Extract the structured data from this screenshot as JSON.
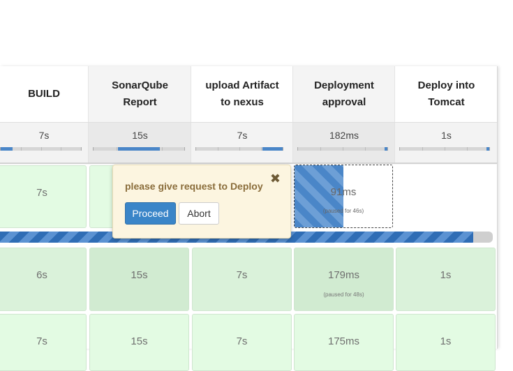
{
  "columns": [
    {
      "title": "BUILD"
    },
    {
      "title": "SonarQube Report"
    },
    {
      "title": "upload Artifact to nexus"
    },
    {
      "title": "Deployment approval"
    },
    {
      "title": "Deploy into Tomcat"
    }
  ],
  "averages": [
    {
      "text": "7s",
      "fill": 0.15
    },
    {
      "text": "15s",
      "fill": 0.46
    },
    {
      "text": "7s",
      "fill": 0.23
    },
    {
      "text": "182ms",
      "fill": 0.03
    },
    {
      "text": "1s",
      "fill": 0.03
    }
  ],
  "runs": [
    {
      "cells": [
        {
          "dur": "7s"
        },
        {
          "dur": ""
        },
        {
          "dur": ""
        },
        {
          "dur": "91ms",
          "note": "(paused for 46s)",
          "progress": 0.5
        },
        {
          "dur": ""
        }
      ]
    },
    {
      "cells": [
        {
          "dur": "6s"
        },
        {
          "dur": "15s"
        },
        {
          "dur": "7s"
        },
        {
          "dur": "179ms",
          "note": "(paused for 48s)"
        },
        {
          "dur": "1s"
        }
      ]
    },
    {
      "cells": [
        {
          "dur": "7s"
        },
        {
          "dur": "15s"
        },
        {
          "dur": "7s"
        },
        {
          "dur": "175ms"
        },
        {
          "dur": "1s"
        }
      ]
    }
  ],
  "run_progress": 0.96,
  "input_prompt": {
    "message": "please give request to Deploy",
    "proceed_label": "Proceed",
    "abort_label": "Abort",
    "close_symbol": "✖"
  },
  "colors": {
    "progress_blue": "#3a85c8",
    "success_green": "#e3fbe3",
    "prompt_bg": "#fcf5e0"
  }
}
